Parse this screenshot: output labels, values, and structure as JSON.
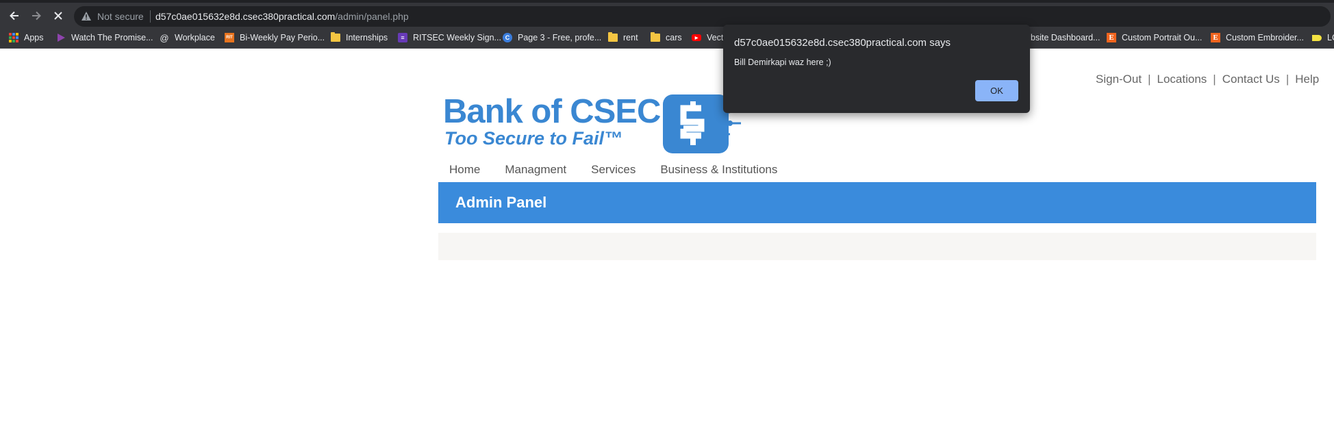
{
  "browser": {
    "security_label": "Not secure",
    "url_host": "d57c0ae015632e8d.csec380practical.com",
    "url_path": "/admin/panel.php",
    "bookmarks": [
      {
        "label": "Apps",
        "icon": "apps-grid-icon"
      },
      {
        "label": "Watch The Promise...",
        "icon": "play-icon",
        "color": "#8e44ad"
      },
      {
        "label": "Workplace",
        "icon": "at-icon"
      },
      {
        "label": "Bi-Weekly Pay Perio...",
        "icon": "rit-icon",
        "color": "#e8731e"
      },
      {
        "label": "Internships",
        "icon": "folder-icon",
        "color": "#f4c542"
      },
      {
        "label": "RITSEC Weekly Sign...",
        "icon": "form-icon",
        "color": "#673ab7"
      },
      {
        "label": "Page 3 - Free, profe...",
        "icon": "c-logo-icon",
        "color": "#3b7ddd"
      },
      {
        "label": "rent",
        "icon": "folder-icon",
        "color": "#f4c542"
      },
      {
        "label": "cars",
        "icon": "folder-icon",
        "color": "#f4c542"
      },
      {
        "label": "Vect",
        "icon": "youtube-icon",
        "color": "#ff0000"
      },
      {
        "label": "bsite Dashboard...",
        "icon": "none"
      },
      {
        "label": "Custom Portrait Ou...",
        "icon": "etsy-icon",
        "color": "#f1641e"
      },
      {
        "label": "Custom Embroider...",
        "icon": "etsy-icon",
        "color": "#f1641e"
      },
      {
        "label": "LC",
        "icon": "tag-icon",
        "color": "#f4e242"
      }
    ]
  },
  "dialog": {
    "title": "d57c0ae015632e8d.csec380practical.com says",
    "message": "Bill Demirkapi waz here ;)",
    "ok_label": "OK"
  },
  "site": {
    "top_links": [
      "Sign-Out",
      "Locations",
      "Contact Us",
      "Help"
    ],
    "logo_title": "Bank of CSEC",
    "logo_tagline": "Too Secure to Fail™",
    "nav": [
      "Home",
      "Managment",
      "Services",
      "Business & Institutions"
    ],
    "panel_title": "Admin Panel"
  },
  "colors": {
    "brand_blue": "#3a87d2",
    "panel_blue": "#3a8bdc",
    "dialog_bg": "#292a2d",
    "ok_button": "#8ab4f8"
  }
}
